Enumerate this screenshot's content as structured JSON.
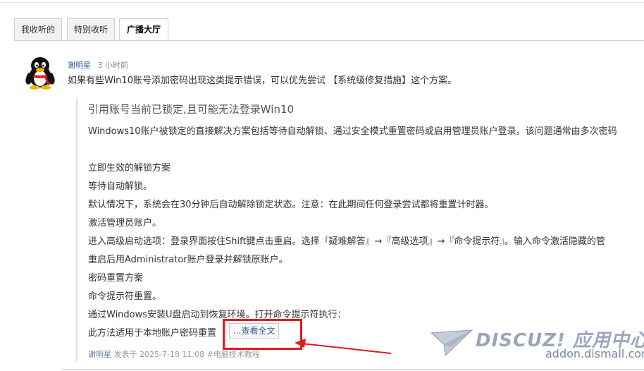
{
  "tabs": [
    {
      "label": "我收听的"
    },
    {
      "label": "特别收听"
    },
    {
      "label": "广播大厅"
    }
  ],
  "post": {
    "author": "谢明星",
    "time": "3 小时前",
    "text": "如果有些Win10账号添加密码出现这类提示错误，可以优先尝试 【系统级修复措施】这个方案。",
    "quote": {
      "title": "引用账号当前已锁定,且可能无法登录Win10",
      "lines": [
        "Windows10账户被锁定的直接解决方案包括等待自动解锁、通过安全模式重置密码或启用管理员账户登录。该问题通常由多次密码",
        "立即生效的解锁方案",
        "等待自动解锁。",
        "默认情况下，系统会在30分钟后自动解除锁定状态。注意：在此期间任何登录尝试都将重置计时器。",
        "激活管理员账户。",
        "进入高级启动选项：登录界面按住Shift键点击重启。选择『疑难解答』→『高级选项』→『命令提示符』。输入命令激活隐藏的管",
        "重启后用Administrator账户登录并解锁原账户。",
        "密码重置方案",
        "命令提示符重置。",
        "通过Windows安装U盘启动到恢复环境。打开命令提示符执行：",
        "此方法适用于本地账户密码重置"
      ],
      "view_all": "...查看全文"
    },
    "footer": {
      "author": "谢明星",
      "posted_at": "发表于 2025-7-18 11:08",
      "tag": "#电脑技术教程"
    }
  },
  "watermark": {
    "logo": "DISCUZ! 应用中心",
    "url": "addon.dismall.com"
  },
  "colors": {
    "highlight": "#e2191e",
    "link": "#336699"
  }
}
